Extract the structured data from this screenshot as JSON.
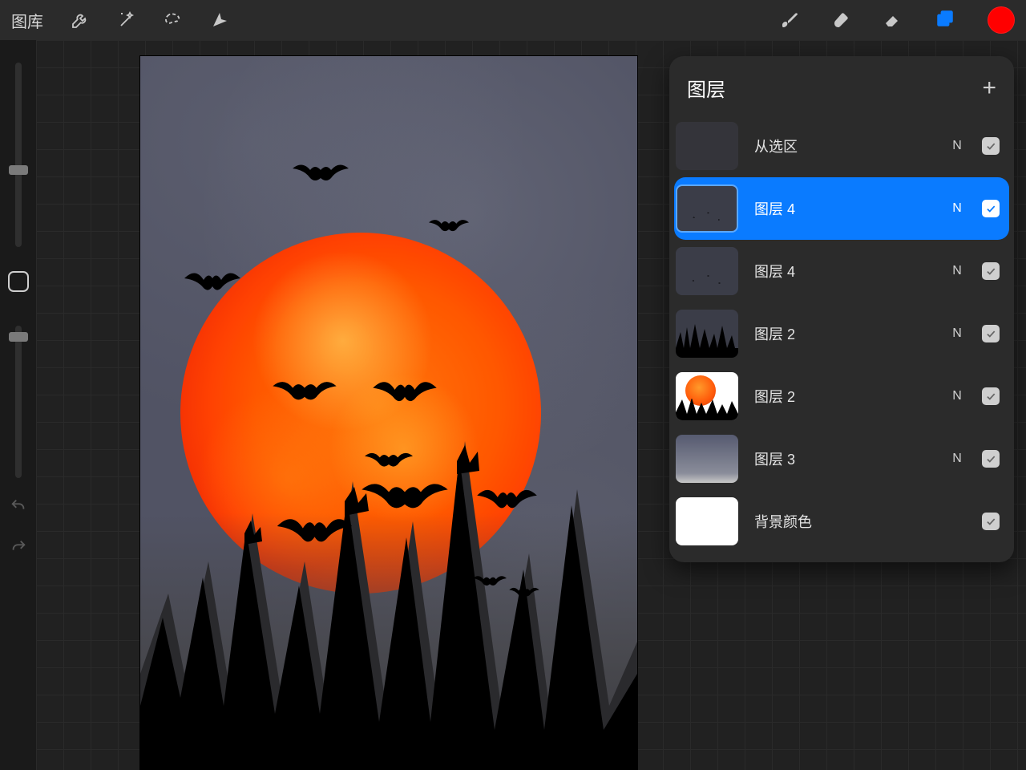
{
  "toolbar": {
    "gallery_label": "图库",
    "color_swatch": "#ff0000"
  },
  "layers_panel": {
    "title": "图层",
    "layers": [
      {
        "name": "从选区",
        "blend": "N",
        "visible": true,
        "selected": false,
        "thumb": "dark"
      },
      {
        "name": "图层 4",
        "blend": "N",
        "visible": true,
        "selected": true,
        "thumb": "bats"
      },
      {
        "name": "图层 4",
        "blend": "N",
        "visible": true,
        "selected": false,
        "thumb": "bats"
      },
      {
        "name": "图层 2",
        "blend": "N",
        "visible": true,
        "selected": false,
        "thumb": "trees"
      },
      {
        "name": "图层 2",
        "blend": "N",
        "visible": true,
        "selected": false,
        "thumb": "moon"
      },
      {
        "name": "图层 3",
        "blend": "N",
        "visible": true,
        "selected": false,
        "thumb": "sky"
      },
      {
        "name": "背景颜色",
        "blend": "",
        "visible": true,
        "selected": false,
        "thumb": "white"
      }
    ]
  }
}
